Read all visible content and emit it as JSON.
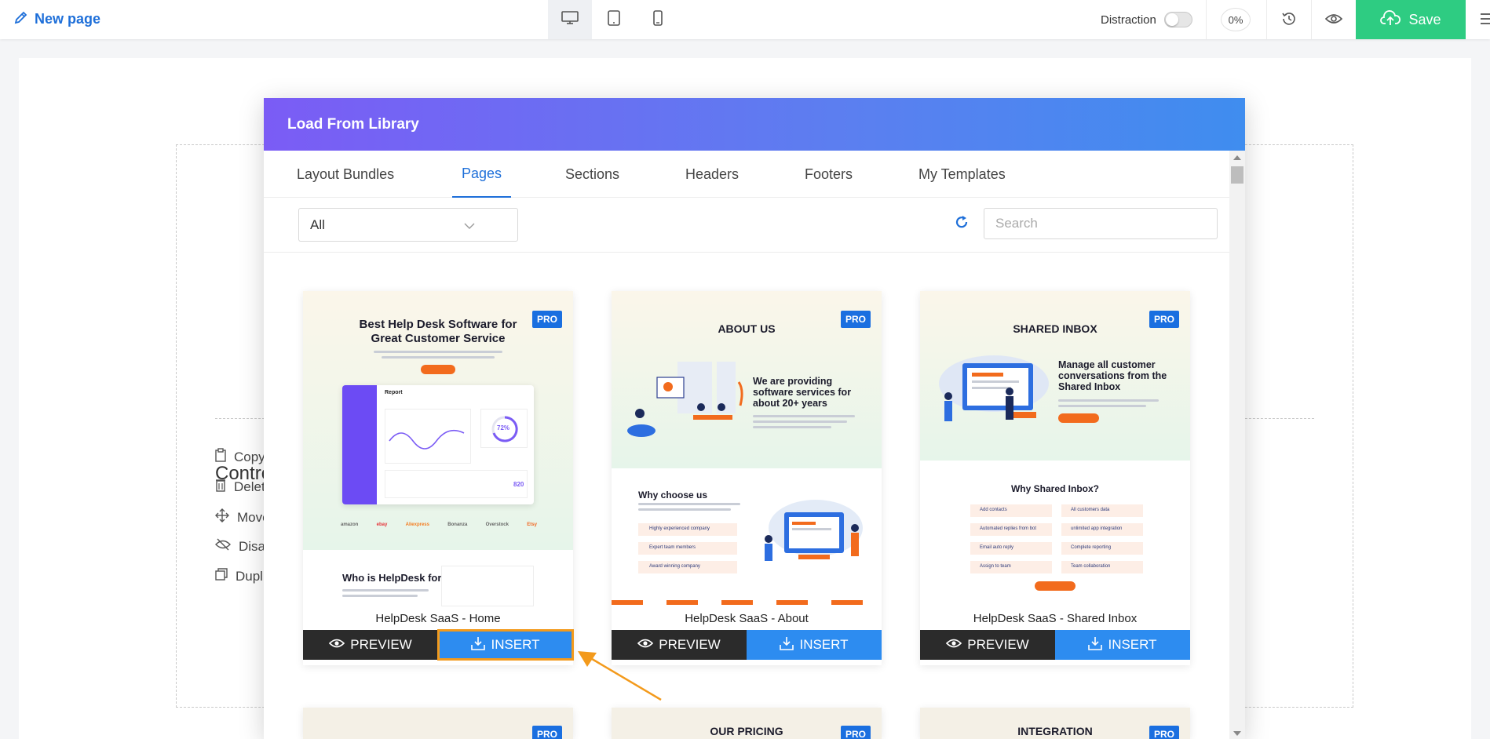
{
  "topbar": {
    "page_title": "New page",
    "distraction_label": "Distraction",
    "progress_text": "0%",
    "save_label": "Save"
  },
  "controls": {
    "title": "Controls",
    "items": [
      "Copy",
      "Delete",
      "Move",
      "Disable",
      "Duplicate"
    ]
  },
  "library": {
    "title": "Load From Library",
    "tabs": [
      "Layout Bundles",
      "Pages",
      "Sections",
      "Headers",
      "Footers",
      "My Templates"
    ],
    "active_tab": "Pages",
    "filter_value": "All",
    "search_placeholder": "Search",
    "pro_badge": "PRO",
    "preview_label": "PREVIEW",
    "insert_label": "INSERT",
    "cards": [
      {
        "title": "HelpDesk SaaS - Home",
        "headline": "Best Help Desk Software for Great Customer Service",
        "dashboard_title": "Report",
        "stat_value": "72%",
        "stat_value_2": "820",
        "sub_heading": "Who is HelpDesk for?",
        "brands": [
          "amazon",
          "ebay",
          "Aliexpress",
          "Bonanza",
          "Overstock",
          "Etsy"
        ]
      },
      {
        "title": "HelpDesk SaaS - About",
        "headline": "ABOUT US",
        "tagline": "We are providing software services for about 20+ years",
        "sub_heading": "Why choose us",
        "features": [
          "Highly experienced company",
          "Expert team members",
          "Award winning company"
        ]
      },
      {
        "title": "HelpDesk SaaS - Shared Inbox",
        "headline": "SHARED INBOX",
        "tagline": "Manage all customer conversations from the Shared Inbox",
        "sub_heading": "Why Shared Inbox?",
        "features": [
          "Add contacts",
          "All customers data",
          "Automated replies from bot",
          "unlimited app integration",
          "Email auto reply",
          "Complete reporting",
          "Assign to team",
          "Team collaboration"
        ]
      }
    ],
    "next_row": [
      "",
      "OUR PRICING",
      "INTEGRATION"
    ]
  },
  "colors": {
    "accent": "#1e6fd9",
    "save": "#2ecc82",
    "insert": "#2d8cf0",
    "highlight": "#f39a1c"
  }
}
